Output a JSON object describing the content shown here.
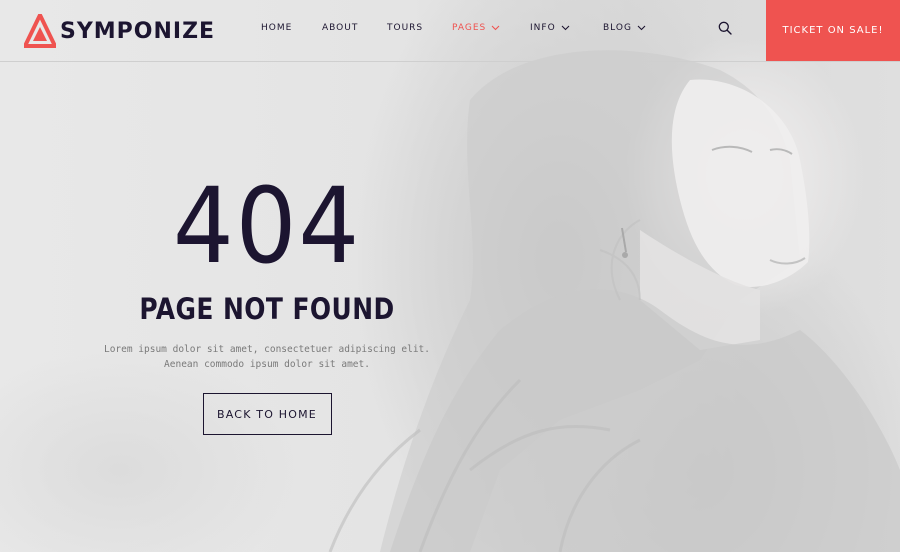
{
  "brand": {
    "name": "SYMPONIZE",
    "accent_color": "#ef5350",
    "text_color": "#1c1530"
  },
  "nav": {
    "items": [
      {
        "label": "HOME",
        "has_dropdown": false,
        "active": false
      },
      {
        "label": "ABOUT",
        "has_dropdown": false,
        "active": false
      },
      {
        "label": "TOURS",
        "has_dropdown": false,
        "active": false
      },
      {
        "label": "PAGES",
        "has_dropdown": true,
        "active": true
      },
      {
        "label": "INFO",
        "has_dropdown": true,
        "active": false
      },
      {
        "label": "BLOG",
        "has_dropdown": true,
        "active": false
      }
    ],
    "search_icon": "search-icon",
    "cta_label": "TICKET ON SALE!"
  },
  "error": {
    "code": "404",
    "title": "PAGE NOT FOUND",
    "description_line1": "Lorem ipsum dolor sit amet, consectetuer adipiscing elit.",
    "description_line2": "Aenean commodo ipsum dolor sit amet.",
    "button_label": "BACK TO HOME"
  }
}
